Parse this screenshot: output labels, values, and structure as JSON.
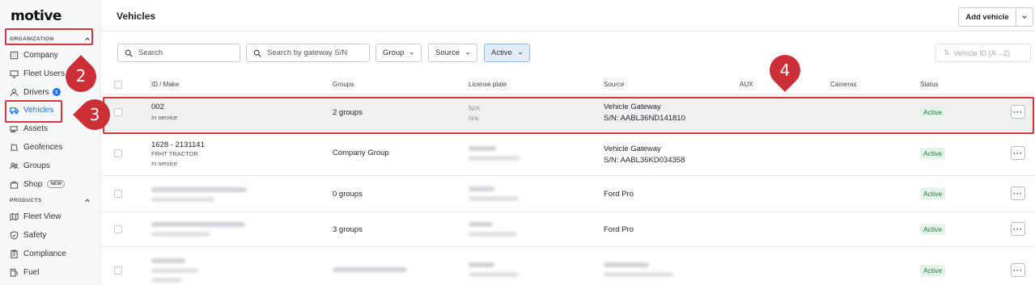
{
  "app": {
    "logo": "motive",
    "page_title": "Vehicles",
    "add_vehicle_label": "Add vehicle"
  },
  "sidebar": {
    "organization_heading": "ORGANIZATION",
    "products_heading": "PRODUCTS",
    "items": [
      {
        "label": "Company",
        "icon": "building-icon"
      },
      {
        "label": "Fleet Users",
        "icon": "monitor-icon"
      },
      {
        "label": "Drivers",
        "icon": "person-icon",
        "badge": "1"
      },
      {
        "label": "Vehicles",
        "icon": "truck-icon",
        "active": true
      },
      {
        "label": "Assets",
        "icon": "trailer-icon"
      },
      {
        "label": "Geofences",
        "icon": "geofence-icon"
      },
      {
        "label": "Groups",
        "icon": "groups-icon"
      },
      {
        "label": "Shop",
        "icon": "shop-icon",
        "badge": "NEW"
      }
    ],
    "product_items": [
      {
        "label": "Fleet View",
        "icon": "map-icon"
      },
      {
        "label": "Safety",
        "icon": "shield-icon"
      },
      {
        "label": "Compliance",
        "icon": "clipboard-icon"
      },
      {
        "label": "Fuel",
        "icon": "fuel-icon"
      }
    ]
  },
  "filters": {
    "search_placeholder": "Search",
    "gateway_placeholder": "Search by gateway S/N",
    "group_label": "Group",
    "source_label": "Source",
    "active_label": "Active",
    "sort_label": "Vehicle ID (A→Z)"
  },
  "table": {
    "columns": [
      "ID / Make",
      "Groups",
      "License plate",
      "Source",
      "AUX",
      "Cameras",
      "Status"
    ],
    "rows": [
      {
        "id": "002",
        "sub": "In service",
        "groups": "2 groups",
        "plate": "N/A",
        "plate_sub": "N/A",
        "source": "Vehicle Gateway",
        "source_sub": "S/N: AABL36ND141810",
        "status": "Active"
      },
      {
        "id": "1628 - 2131141",
        "make": "FRHT TRACTOR",
        "sub": "In service",
        "groups": "Company Group",
        "source": "Vehicle Gateway",
        "source_sub": "S/N: AABL36KD034358",
        "status": "Active"
      },
      {
        "groups": "0 groups",
        "source": "Ford Pro",
        "status": "Active"
      },
      {
        "groups": "3 groups",
        "source": "Ford Pro",
        "status": "Active"
      },
      {
        "status": "Active"
      }
    ]
  },
  "annotations": [
    "2",
    "3",
    "4"
  ],
  "colors": {
    "accent": "#1a73e8",
    "annotation_red": "#cc2f35",
    "status_green": "#217a3c"
  }
}
